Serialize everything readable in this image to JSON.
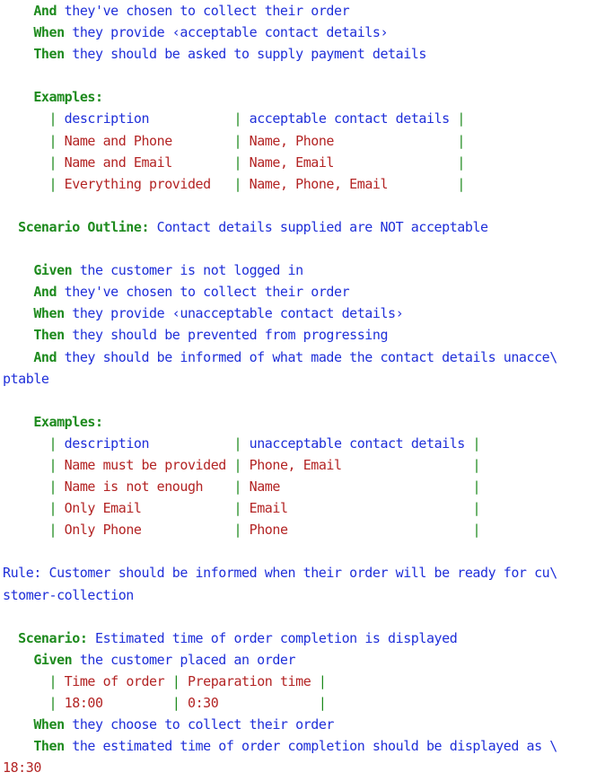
{
  "colors": {
    "keyword": "#1d8a1d",
    "step": "#1f2fd9",
    "table": "#b32424",
    "text": "#1f2fd9"
  },
  "lines": [
    {
      "indent": 4,
      "segments": [
        {
          "text": "And",
          "role": "keyword"
        },
        {
          "text": " they've chosen to collect their order",
          "role": "step"
        }
      ]
    },
    {
      "indent": 4,
      "segments": [
        {
          "text": "When",
          "role": "keyword"
        },
        {
          "text": " they provide ‹acceptable contact details›",
          "role": "step"
        }
      ]
    },
    {
      "indent": 4,
      "segments": [
        {
          "text": "Then",
          "role": "keyword"
        },
        {
          "text": " they should be asked to supply payment details",
          "role": "step"
        }
      ]
    },
    {
      "indent": 0,
      "segments": []
    },
    {
      "indent": 4,
      "segments": [
        {
          "text": "Examples:",
          "role": "keyword"
        }
      ]
    },
    {
      "indent": 6,
      "segments": [
        {
          "text": "| ",
          "role": "keyword"
        },
        {
          "text": "description           ",
          "role": "step"
        },
        {
          "text": "| ",
          "role": "keyword"
        },
        {
          "text": "acceptable contact details ",
          "role": "step"
        },
        {
          "text": "|",
          "role": "keyword"
        }
      ]
    },
    {
      "indent": 6,
      "segments": [
        {
          "text": "| ",
          "role": "keyword"
        },
        {
          "text": "Name and Phone        ",
          "role": "table"
        },
        {
          "text": "| ",
          "role": "keyword"
        },
        {
          "text": "Name, Phone                ",
          "role": "table"
        },
        {
          "text": "|",
          "role": "keyword"
        }
      ]
    },
    {
      "indent": 6,
      "segments": [
        {
          "text": "| ",
          "role": "keyword"
        },
        {
          "text": "Name and Email        ",
          "role": "table"
        },
        {
          "text": "| ",
          "role": "keyword"
        },
        {
          "text": "Name, Email                ",
          "role": "table"
        },
        {
          "text": "|",
          "role": "keyword"
        }
      ]
    },
    {
      "indent": 6,
      "segments": [
        {
          "text": "| ",
          "role": "keyword"
        },
        {
          "text": "Everything provided   ",
          "role": "table"
        },
        {
          "text": "| ",
          "role": "keyword"
        },
        {
          "text": "Name, Phone, Email         ",
          "role": "table"
        },
        {
          "text": "|",
          "role": "keyword"
        }
      ]
    },
    {
      "indent": 0,
      "segments": []
    },
    {
      "indent": 2,
      "segments": [
        {
          "text": "Scenario Outline:",
          "role": "keyword"
        },
        {
          "text": " Contact details supplied are NOT acceptable",
          "role": "step"
        }
      ]
    },
    {
      "indent": 0,
      "segments": []
    },
    {
      "indent": 4,
      "segments": [
        {
          "text": "Given",
          "role": "keyword"
        },
        {
          "text": " the customer is not logged in",
          "role": "step"
        }
      ]
    },
    {
      "indent": 4,
      "segments": [
        {
          "text": "And",
          "role": "keyword"
        },
        {
          "text": " they've chosen to collect their order",
          "role": "step"
        }
      ]
    },
    {
      "indent": 4,
      "segments": [
        {
          "text": "When",
          "role": "keyword"
        },
        {
          "text": " they provide ‹unacceptable contact details›",
          "role": "step"
        }
      ]
    },
    {
      "indent": 4,
      "segments": [
        {
          "text": "Then",
          "role": "keyword"
        },
        {
          "text": " they should be prevented from progressing",
          "role": "step"
        }
      ]
    },
    {
      "indent": 4,
      "segments": [
        {
          "text": "And",
          "role": "keyword"
        },
        {
          "text": " they should be informed of what made the contact details unacce\\",
          "role": "step"
        }
      ]
    },
    {
      "indent": 0,
      "segments": [
        {
          "text": "ptable",
          "role": "step"
        }
      ]
    },
    {
      "indent": 0,
      "segments": []
    },
    {
      "indent": 4,
      "segments": [
        {
          "text": "Examples:",
          "role": "keyword"
        }
      ]
    },
    {
      "indent": 6,
      "segments": [
        {
          "text": "| ",
          "role": "keyword"
        },
        {
          "text": "description           ",
          "role": "step"
        },
        {
          "text": "| ",
          "role": "keyword"
        },
        {
          "text": "unacceptable contact details ",
          "role": "step"
        },
        {
          "text": "|",
          "role": "keyword"
        }
      ]
    },
    {
      "indent": 6,
      "segments": [
        {
          "text": "| ",
          "role": "keyword"
        },
        {
          "text": "Name must be provided ",
          "role": "table"
        },
        {
          "text": "| ",
          "role": "keyword"
        },
        {
          "text": "Phone, Email                 ",
          "role": "table"
        },
        {
          "text": "|",
          "role": "keyword"
        }
      ]
    },
    {
      "indent": 6,
      "segments": [
        {
          "text": "| ",
          "role": "keyword"
        },
        {
          "text": "Name is not enough    ",
          "role": "table"
        },
        {
          "text": "| ",
          "role": "keyword"
        },
        {
          "text": "Name                         ",
          "role": "table"
        },
        {
          "text": "|",
          "role": "keyword"
        }
      ]
    },
    {
      "indent": 6,
      "segments": [
        {
          "text": "| ",
          "role": "keyword"
        },
        {
          "text": "Only Email            ",
          "role": "table"
        },
        {
          "text": "| ",
          "role": "keyword"
        },
        {
          "text": "Email                        ",
          "role": "table"
        },
        {
          "text": "|",
          "role": "keyword"
        }
      ]
    },
    {
      "indent": 6,
      "segments": [
        {
          "text": "| ",
          "role": "keyword"
        },
        {
          "text": "Only Phone            ",
          "role": "table"
        },
        {
          "text": "| ",
          "role": "keyword"
        },
        {
          "text": "Phone                        ",
          "role": "table"
        },
        {
          "text": "|",
          "role": "keyword"
        }
      ]
    },
    {
      "indent": 0,
      "segments": []
    },
    {
      "indent": 0,
      "segments": [
        {
          "text": "Rule: Customer should be informed when their order will be ready for cu\\",
          "role": "text"
        }
      ]
    },
    {
      "indent": 0,
      "segments": [
        {
          "text": "stomer-collection",
          "role": "text"
        }
      ]
    },
    {
      "indent": 0,
      "segments": []
    },
    {
      "indent": 2,
      "segments": [
        {
          "text": "Scenario:",
          "role": "keyword"
        },
        {
          "text": " Estimated time of order completion is displayed",
          "role": "step"
        }
      ]
    },
    {
      "indent": 4,
      "segments": [
        {
          "text": "Given",
          "role": "keyword"
        },
        {
          "text": " the customer placed an order",
          "role": "step"
        }
      ]
    },
    {
      "indent": 6,
      "segments": [
        {
          "text": "| ",
          "role": "keyword"
        },
        {
          "text": "Time of order ",
          "role": "table"
        },
        {
          "text": "| ",
          "role": "keyword"
        },
        {
          "text": "Preparation time ",
          "role": "table"
        },
        {
          "text": "|",
          "role": "keyword"
        }
      ]
    },
    {
      "indent": 6,
      "segments": [
        {
          "text": "| ",
          "role": "keyword"
        },
        {
          "text": "18:00         ",
          "role": "table"
        },
        {
          "text": "| ",
          "role": "keyword"
        },
        {
          "text": "0:30             ",
          "role": "table"
        },
        {
          "text": "|",
          "role": "keyword"
        }
      ]
    },
    {
      "indent": 4,
      "segments": [
        {
          "text": "When",
          "role": "keyword"
        },
        {
          "text": " they choose to collect their order",
          "role": "step"
        }
      ]
    },
    {
      "indent": 4,
      "segments": [
        {
          "text": "Then",
          "role": "keyword"
        },
        {
          "text": " the estimated time of order completion should be displayed as \\",
          "role": "step"
        }
      ]
    },
    {
      "indent": 0,
      "segments": [
        {
          "text": "18:30",
          "role": "table"
        }
      ]
    }
  ]
}
